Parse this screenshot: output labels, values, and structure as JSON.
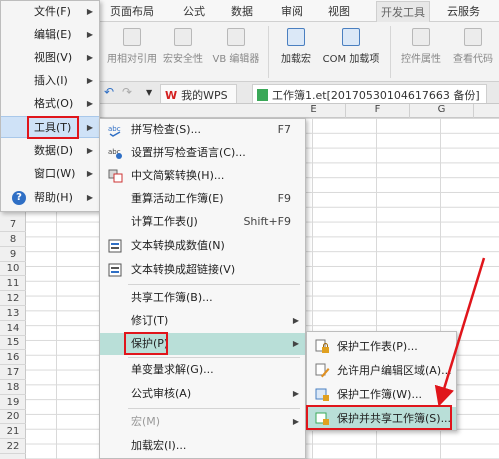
{
  "ribbon": {
    "tabs": [
      "页面布局",
      "公式",
      "数据",
      "审阅",
      "视图",
      "开发工具",
      "云服务"
    ],
    "buttons": [
      "用相对引用",
      "宏安全性",
      "VB 编辑器",
      "加载宏",
      "COM 加载项",
      "控件属性",
      "查看代码"
    ]
  },
  "doc_tabs": {
    "wps_label": "我的WPS",
    "workbook_label": "工作簿1.et[20170530104617663 备份]"
  },
  "columns": [
    "E",
    "F",
    "G"
  ],
  "rows": [
    "7",
    "8",
    "9",
    "10",
    "11",
    "12",
    "13",
    "14",
    "15",
    "16",
    "17",
    "18",
    "19",
    "20",
    "21",
    "22"
  ],
  "main_menu": [
    {
      "label": "文件(F)"
    },
    {
      "label": "编辑(E)"
    },
    {
      "label": "视图(V)"
    },
    {
      "label": "插入(I)"
    },
    {
      "label": "格式(O)"
    },
    {
      "label": "工具(T)"
    },
    {
      "label": "数据(D)"
    },
    {
      "label": "窗口(W)"
    },
    {
      "label": "帮助(H)"
    }
  ],
  "tools_menu": [
    {
      "label": "拼写检查(S)...",
      "shortcut": "F7",
      "icon": "spell-check-icon"
    },
    {
      "label": "设置拼写检查语言(C)...",
      "icon": "spell-language-icon"
    },
    {
      "label": "中文简繁转换(H)...",
      "icon": "chinese-convert-icon"
    },
    {
      "label": "重算活动工作簿(E)",
      "shortcut": "F9"
    },
    {
      "label": "计算工作表(J)",
      "shortcut": "Shift+F9"
    },
    {
      "label": "文本转换成数值(N)",
      "icon": "text-to-number-icon"
    },
    {
      "label": "文本转换成超链接(V)",
      "icon": "text-to-hyperlink-icon"
    },
    {
      "label": "共享工作簿(B)..."
    },
    {
      "label": "修订(T)"
    },
    {
      "label": "保护(P)"
    },
    {
      "label": "单变量求解(G)..."
    },
    {
      "label": "公式审核(A)"
    },
    {
      "label": "宏(M)"
    },
    {
      "label": "加载宏(I)..."
    }
  ],
  "protect_menu": [
    {
      "label": "保护工作表(P)...",
      "icon": "protect-sheet-icon"
    },
    {
      "label": "允许用户编辑区域(A)...",
      "icon": "allow-edit-icon"
    },
    {
      "label": "保护工作簿(W)...",
      "icon": "protect-workbook-icon"
    },
    {
      "label": "保护并共享工作簿(S)...",
      "icon": "protect-share-icon"
    }
  ],
  "colors": {
    "highlight": "#b9dfd8",
    "annotation": "#e0151b",
    "wps_red": "#d42020"
  }
}
